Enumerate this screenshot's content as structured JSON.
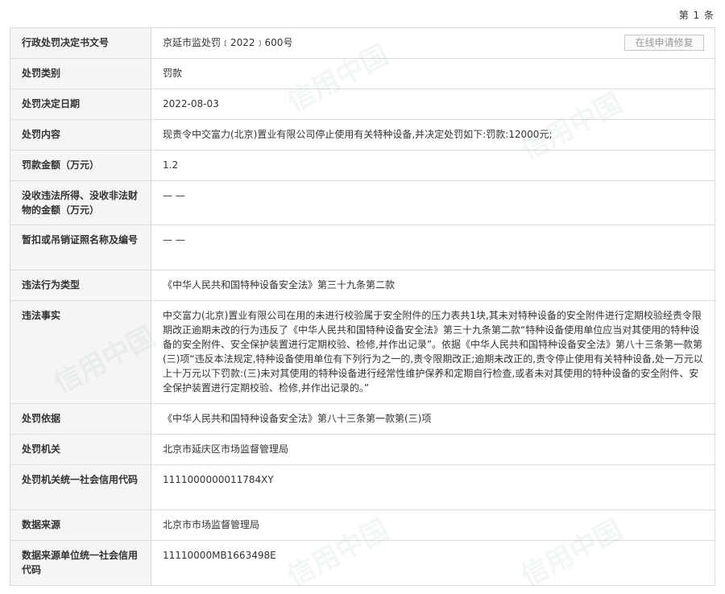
{
  "page_indicator": "第 1 条",
  "repair_button_label": "在线申请修复",
  "watermark_text": "信用中国",
  "rows": [
    {
      "label": "行政处罚决定书文号",
      "value": "京延市监处罚﹝2022﹞600号"
    },
    {
      "label": "处罚类别",
      "value": "罚款"
    },
    {
      "label": "处罚决定日期",
      "value": "2022-08-03"
    },
    {
      "label": "处罚内容",
      "value": "现责令中交富力(北京)置业有限公司停止使用有关特种设备,并决定处罚如下:罚款:12000元;"
    },
    {
      "label": "罚款金额（万元）",
      "value": "1.2"
    },
    {
      "label": "没收违法所得、没收非法财物的金额（万元）",
      "value": "— —"
    },
    {
      "label": "暂扣或吊销证照名称及编号",
      "value": "— —"
    },
    {
      "label": "违法行为类型",
      "value": "《中华人民共和国特种设备安全法》第三十九条第二款"
    },
    {
      "label": "违法事实",
      "value": "中交富力(北京)置业有限公司在用的未进行校验属于安全附件的压力表共1块,其未对特种设备的安全附件进行定期校验经责令限期改正逾期未改的行为违反了《中华人民共和国特种设备安全法》第三十九条第二款“特种设备使用单位应当对其使用的特种设备的安全附件、安全保护装置进行定期校验、检修,并作出记录”。依据《中华人民共和国特种设备安全法》第八十三条第一款第(三)项“违反本法规定,特种设备使用单位有下列行为之一的,责令限期改正;逾期未改正的,责令停止使用有关特种设备,处一万元以上十万元以下罚款:(三)未对其使用的特种设备进行经常性维护保养和定期自行检查,或者未对其使用的特种设备的安全附件、安全保护装置进行定期校验、检修,并作出记录的。”"
    },
    {
      "label": "处罚依据",
      "value": "《中华人民共和国特种设备安全法》第八十三条第一款第(三)项"
    },
    {
      "label": "处罚机关",
      "value": "北京市延庆区市场监督管理局"
    },
    {
      "label": "处罚机关统一社会信用代码",
      "value": "1111000000011784XY"
    },
    {
      "label": "数据来源",
      "value": "北京市市场监督管理局"
    },
    {
      "label": "数据来源单位统一社会信用代码",
      "value": "11110000MB1663498E"
    }
  ]
}
